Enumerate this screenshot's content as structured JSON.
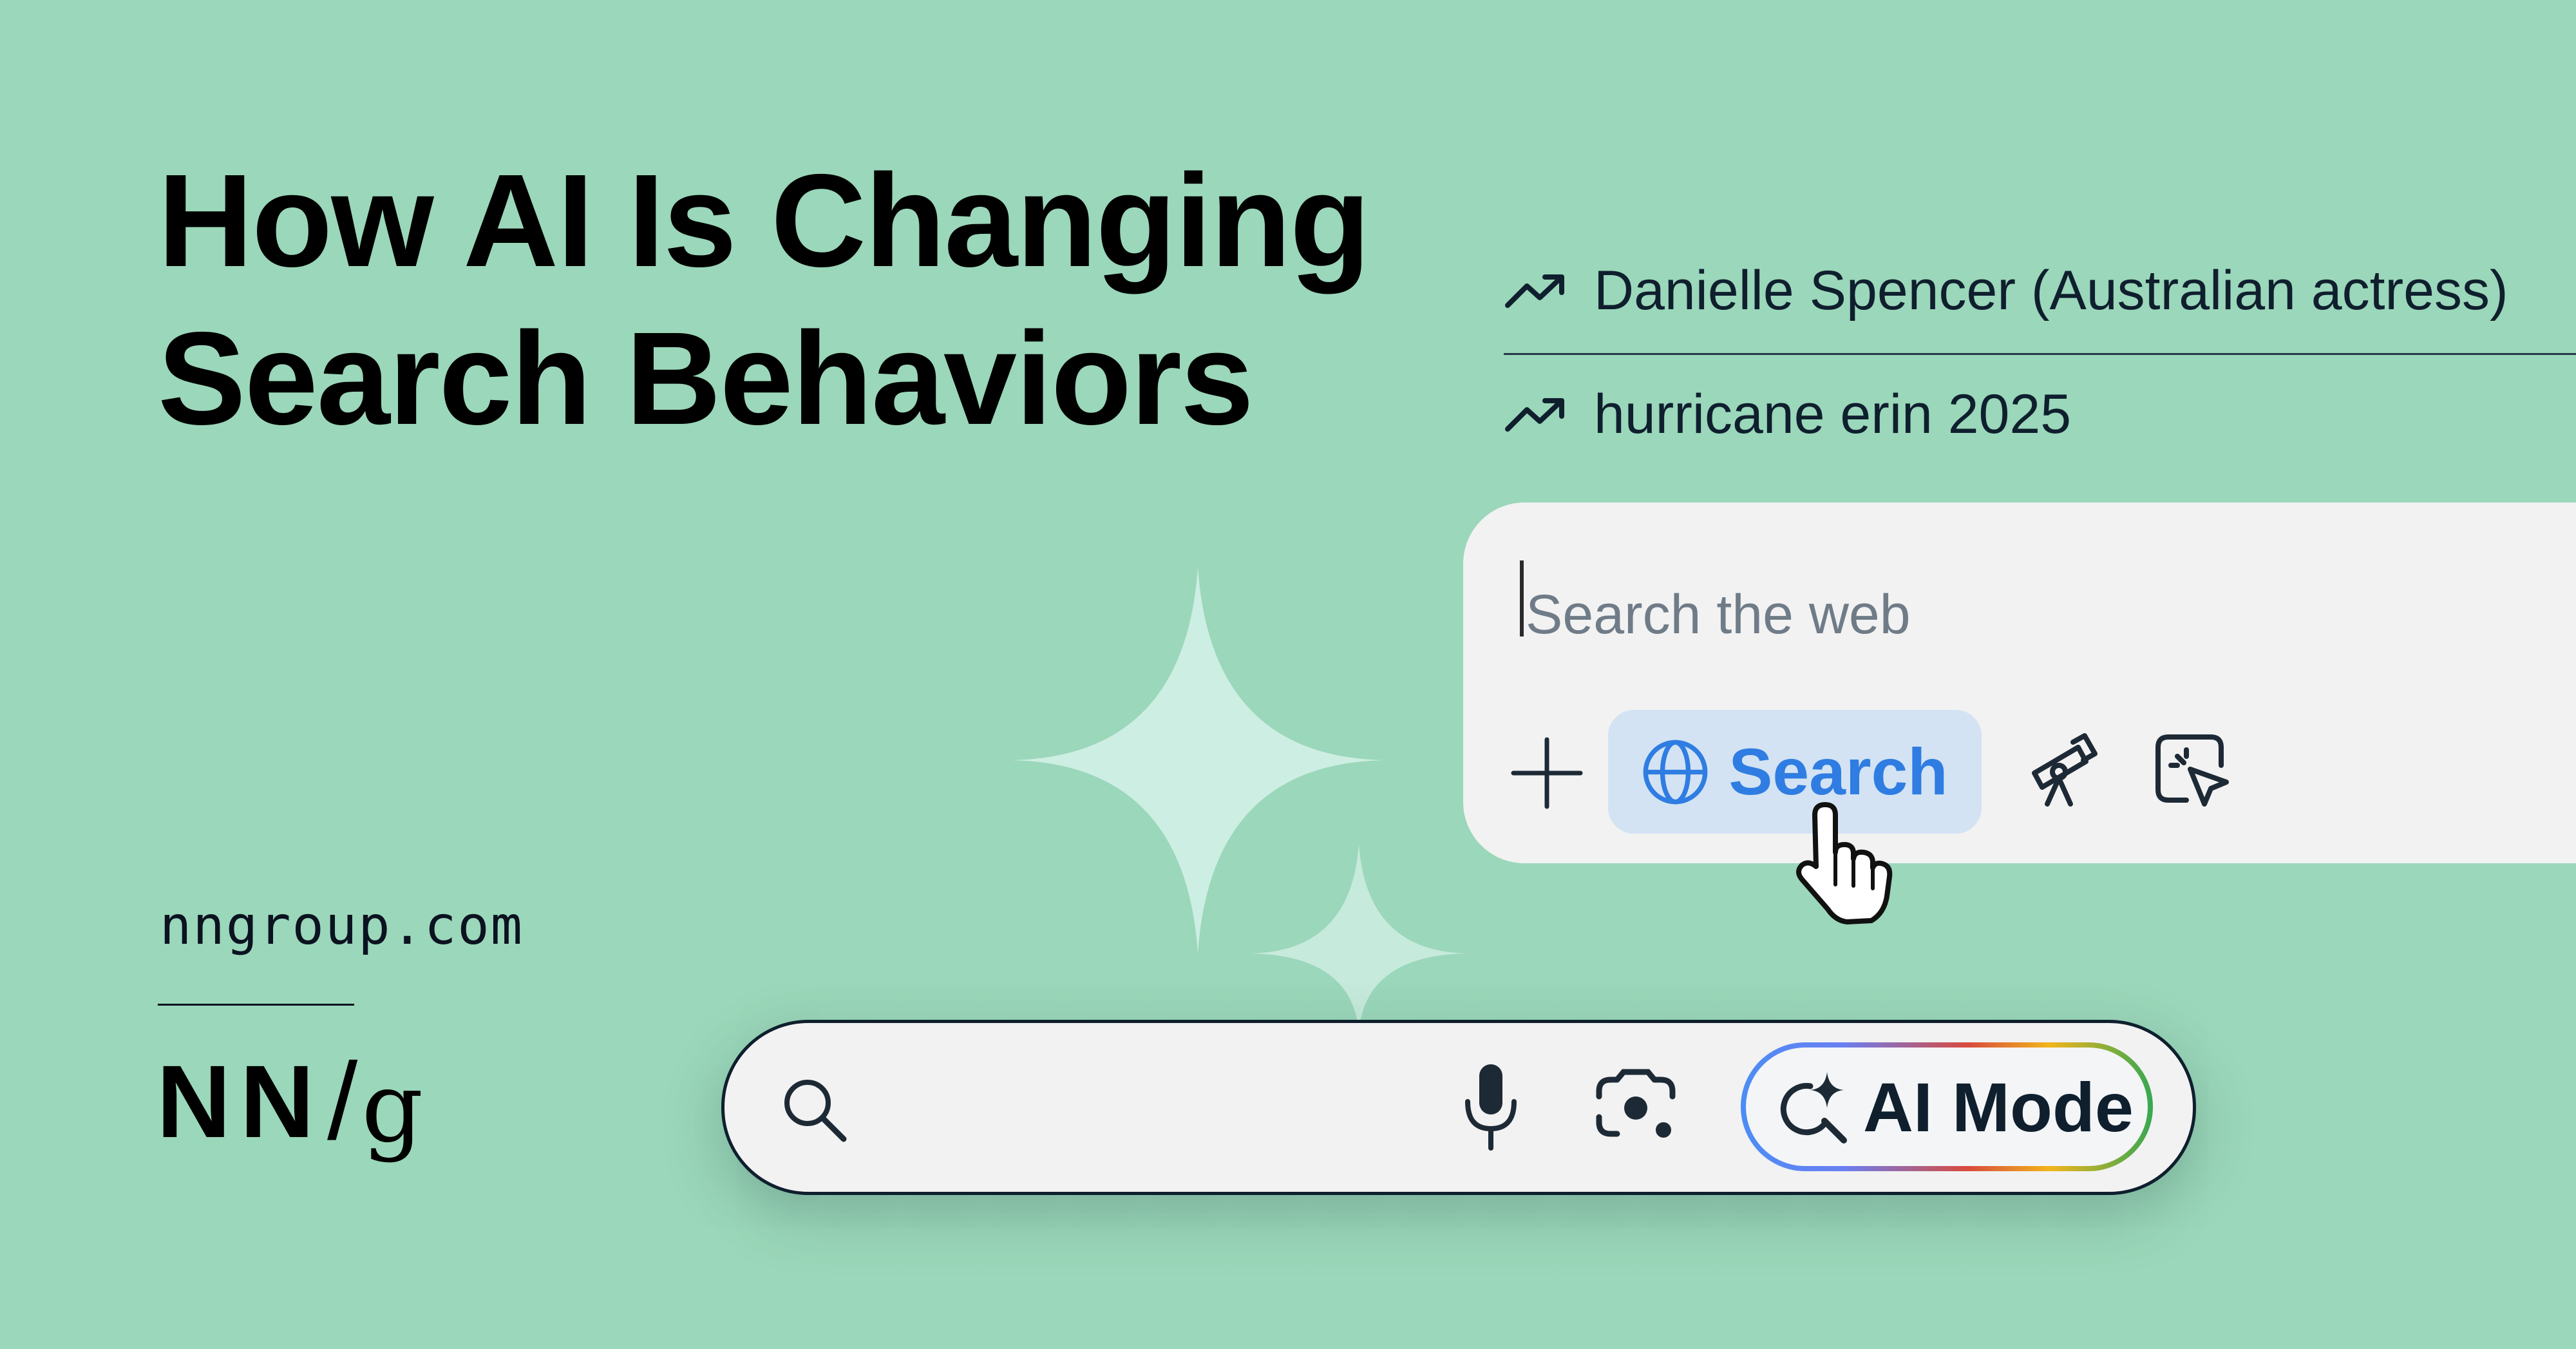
{
  "headline": {
    "line1": "How AI Is Changing",
    "line2": "Search Behaviors"
  },
  "brand": {
    "site": "nngroup.com",
    "logo_nn": "NN",
    "logo_slash": "/",
    "logo_g": "g"
  },
  "suggestions": [
    {
      "label": "Danielle Spencer (Australian actress)",
      "icon": "trending-up-icon"
    },
    {
      "label": "hurricane erin 2025",
      "icon": "trending-up-icon"
    }
  ],
  "search_panel": {
    "placeholder": "Search the web",
    "search_chip_label": "Search",
    "icons": [
      "plus-icon",
      "globe-icon",
      "telescope-icon",
      "cursor-select-icon"
    ]
  },
  "search_bar": {
    "ai_mode_label": "AI Mode",
    "icons": [
      "search-icon",
      "microphone-icon",
      "camera-lens-icon",
      "ai-search-sparkle-icon"
    ]
  },
  "colors": {
    "background": "#9bd7ba",
    "chip_background": "#d3e3f3",
    "chip_text": "#2f7de2",
    "dark_text": "#0f1f2e"
  }
}
